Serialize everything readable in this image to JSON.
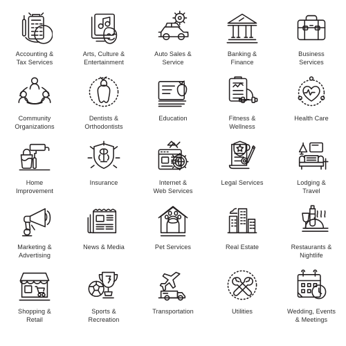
{
  "page": {
    "title": "Business Category Line Icons",
    "background_color": "#ffffff",
    "icon_stroke_color": "#231f20",
    "label_color": "#2b2b2b",
    "columns": 5,
    "rows": 5
  },
  "icons": [
    {
      "icon": "calculator-receipt-icon",
      "label": "Accounting &\nTax Services"
    },
    {
      "icon": "music-note-theater-mask-icon",
      "label": "Arts, Culture &\nEntertainment"
    },
    {
      "icon": "car-gear-icon",
      "label": "Auto Sales &\nService"
    },
    {
      "icon": "bank-building-icon",
      "label": "Banking &\nFinance"
    },
    {
      "icon": "briefcase-icon",
      "label": "Business\nServices"
    },
    {
      "icon": "people-circle-icon",
      "label": "Community\nOrganizations"
    },
    {
      "icon": "tooth-apple-icon",
      "label": "Dentists &\nOrthodontists"
    },
    {
      "icon": "book-apple-icon",
      "label": "Education"
    },
    {
      "icon": "clipboard-dumbbell-icon",
      "label": "Fitness &\nWellness"
    },
    {
      "icon": "heart-pulse-icon",
      "label": "Health Care"
    },
    {
      "icon": "paint-roller-bucket-icon",
      "label": "Home\nImprovement"
    },
    {
      "icon": "shield-caduceus-icon",
      "label": "Insurance"
    },
    {
      "icon": "browser-globe-gear-icon",
      "label": "Internet &\nWeb Services"
    },
    {
      "icon": "legal-scroll-shield-icon",
      "label": "Legal Services"
    },
    {
      "icon": "sofa-lamp-icon",
      "label": "Lodging &\nTravel"
    },
    {
      "icon": "megaphone-icon",
      "label": "Marketing &\nAdvertising"
    },
    {
      "icon": "newspaper-icon",
      "label": "News & Media"
    },
    {
      "icon": "pet-house-paw-icon",
      "label": "Pet Services"
    },
    {
      "icon": "city-buildings-icon",
      "label": "Real Estate"
    },
    {
      "icon": "wine-cloche-icon",
      "label": "Restaurants &\nNightlife"
    },
    {
      "icon": "storefront-cart-icon",
      "label": "Shopping &\nRetail"
    },
    {
      "icon": "trophy-soccer-ball-icon",
      "label": "Sports &\nRecreation"
    },
    {
      "icon": "airplane-truck-icon",
      "label": "Transportation"
    },
    {
      "icon": "wrench-screwdriver-icon",
      "label": "Utilities"
    },
    {
      "icon": "calendar-clock-icon",
      "label": "Wedding, Events\n& Meetings"
    }
  ]
}
